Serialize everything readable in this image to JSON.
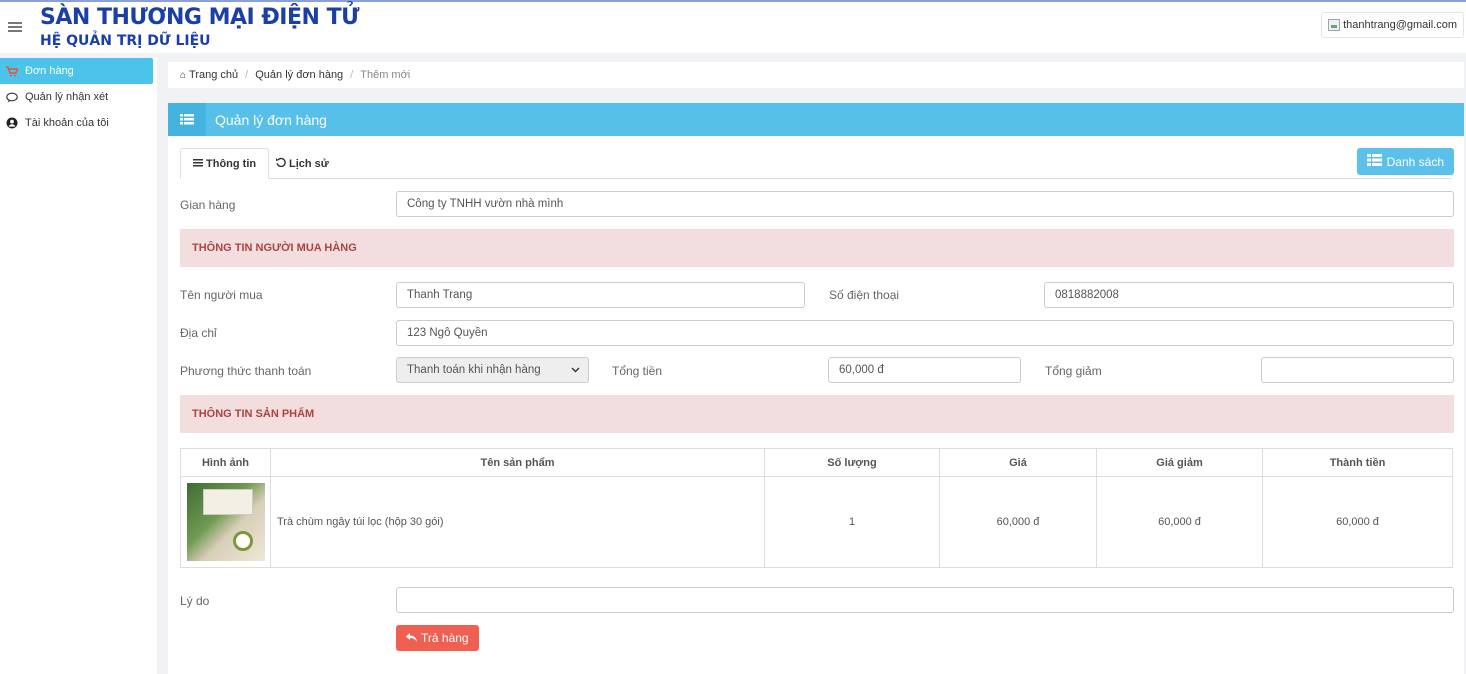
{
  "header": {
    "title": "SÀN THƯƠNG MẠI ĐIỆN TỬ",
    "subtitle": "HỆ QUẢN TRỊ DỮ LIỆU",
    "user_email": "thanhtrang@gmail.com"
  },
  "sidebar": {
    "items": [
      {
        "label": "Đơn hàng",
        "icon": "cart-icon",
        "active": true
      },
      {
        "label": "Quản lý nhận xét",
        "icon": "comment-icon",
        "active": false
      },
      {
        "label": "Tài khoản của tôi",
        "icon": "user-circle-icon",
        "active": false
      }
    ]
  },
  "breadcrumb": {
    "home": "Trang chủ",
    "level1": "Quản lý đơn hàng",
    "current": "Thêm mới"
  },
  "panel": {
    "title": "Quản lý đơn hàng",
    "tabs": [
      {
        "label": "Thông tin",
        "icon": "list-icon"
      },
      {
        "label": "Lịch sử",
        "icon": "history-icon"
      }
    ],
    "list_button": "Danh sách"
  },
  "form": {
    "store_label": "Gian hàng",
    "store_value": "Công ty TNHH vườn nhà mình",
    "buyer_section": "THÔNG TIN NGƯỜI MUA HÀNG",
    "buyer_name_label": "Tên người mua",
    "buyer_name_value": "Thanh Trang",
    "phone_label": "Số điện thoại",
    "phone_value": "0818882008",
    "address_label": "Địa chỉ",
    "address_value": "123 Ngô Quyền",
    "payment_label": "Phương thức thanh toán",
    "payment_value": "Thanh toán khi nhận hàng",
    "total_label": "Tổng tiền",
    "total_value": "60,000 đ",
    "discount_label": "Tổng giảm",
    "discount_value": "",
    "product_section": "THÔNG TIN SẢN PHẨM",
    "reason_label": "Lý do",
    "reason_value": "",
    "return_button": "Trả hàng"
  },
  "products": {
    "headers": [
      "Hình ảnh",
      "Tên sản phẩm",
      "Số lượng",
      "Giá",
      "Giá giảm",
      "Thành tiền"
    ],
    "rows": [
      {
        "name": "Trà chùm ngây túi lọc (hộp 30 gói)",
        "qty": "1",
        "price": "60,000 đ",
        "discount_price": "60,000 đ",
        "subtotal": "60,000 đ"
      }
    ]
  },
  "colors": {
    "accent": "#56c0e8",
    "brand": "#1a3fa6",
    "danger": "#ef6053",
    "section_bg": "#f2dede",
    "section_text": "#a94442"
  }
}
